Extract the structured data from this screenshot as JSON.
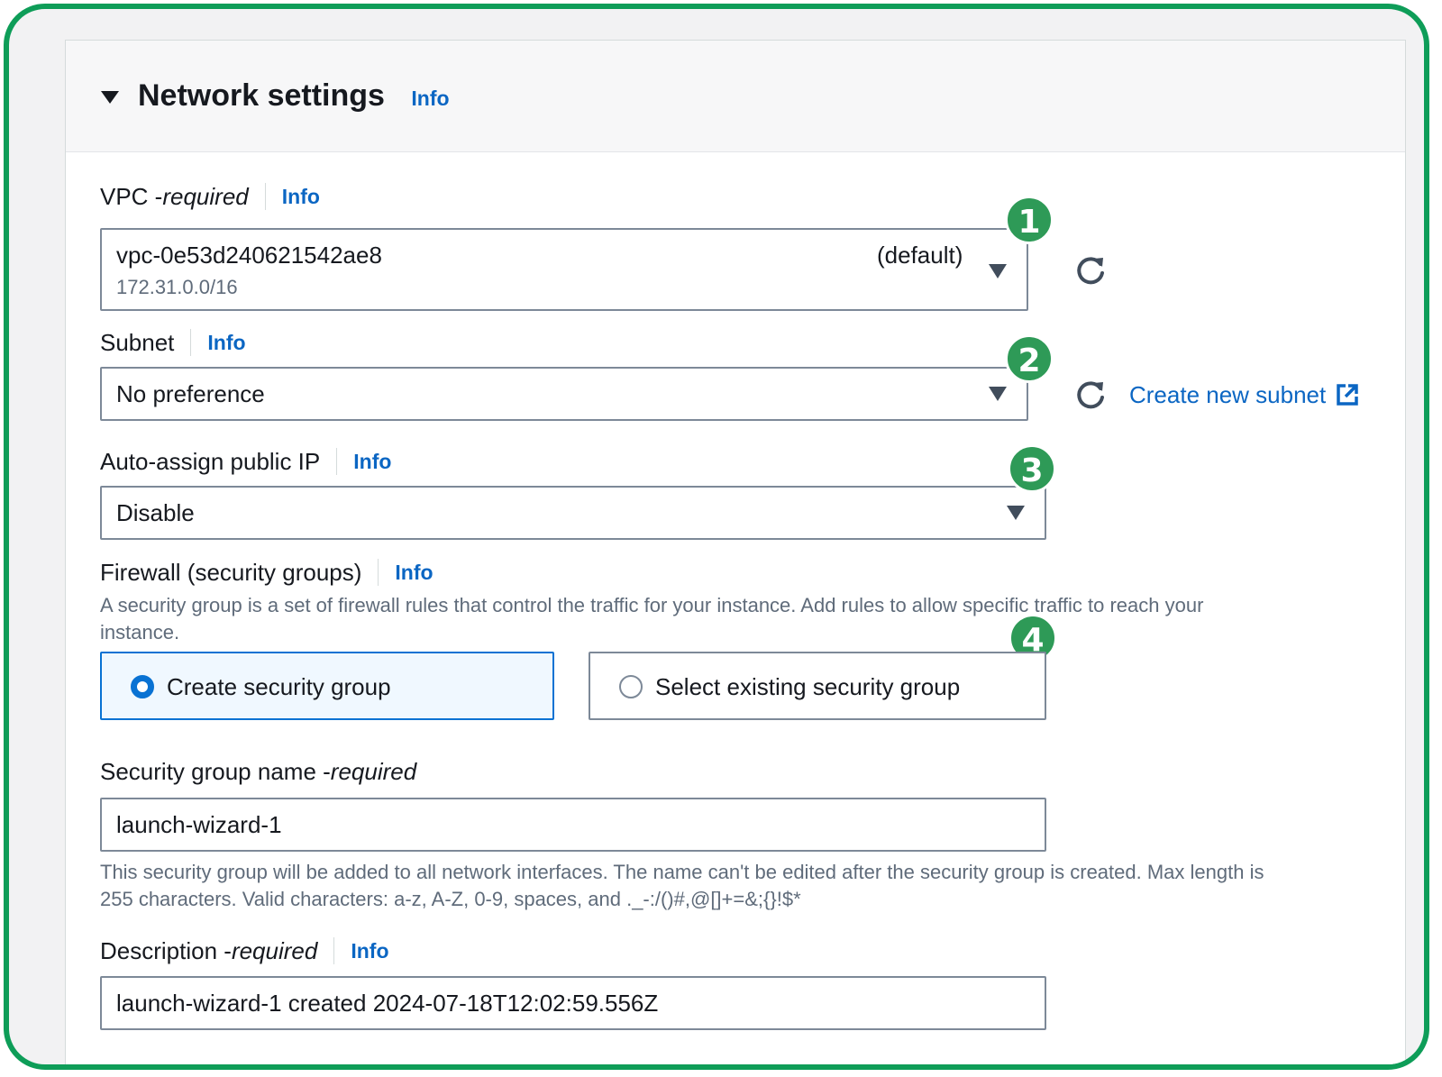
{
  "header": {
    "title": "Network settings",
    "info": "Info"
  },
  "vpc": {
    "label": "VPC - ",
    "required": "required",
    "info": "Info",
    "value": "vpc-0e53d240621542ae8",
    "cidr": "172.31.0.0/16",
    "default_tag": "(default)",
    "badge": "1"
  },
  "subnet": {
    "label": "Subnet",
    "info": "Info",
    "value": "No preference",
    "badge": "2",
    "create_link": "Create new subnet"
  },
  "public_ip": {
    "label": "Auto-assign public IP",
    "info": "Info",
    "value": "Disable",
    "badge": "3"
  },
  "firewall": {
    "label": "Firewall (security groups)",
    "info": "Info",
    "description_line1": "A security group is a set of firewall rules that control the traffic for your instance. Add rules to allow specific traffic to reach your",
    "description_line2": "instance.",
    "badge": "4",
    "option_create": "Create security group",
    "option_existing": "Select existing security group",
    "selected": "Create security group"
  },
  "sg_name": {
    "label": "Security group name - ",
    "required": "required",
    "value": "launch-wizard-1",
    "help_line1": "This security group will be added to all network interfaces. The name can't be edited after the security group is created. Max length is",
    "help_line2": "255 characters. Valid characters: a-z, A-Z, 0-9, spaces, and ._-:/()#,@[]+=&;{}!$*"
  },
  "description": {
    "label": "Description - ",
    "required": "required",
    "info": "Info",
    "value": "launch-wizard-1 created 2024-07-18T12:02:59.556Z"
  },
  "colors": {
    "frame": "#0e9d58",
    "badge": "#2e9a57",
    "link": "#0b66c3",
    "selected_fill": "#f0f8ff",
    "selected_border": "#0972d3"
  },
  "icons": {
    "caret": "caret-down-icon",
    "dropdown": "triangle-down-icon",
    "refresh": "refresh-icon",
    "external": "external-link-icon"
  }
}
